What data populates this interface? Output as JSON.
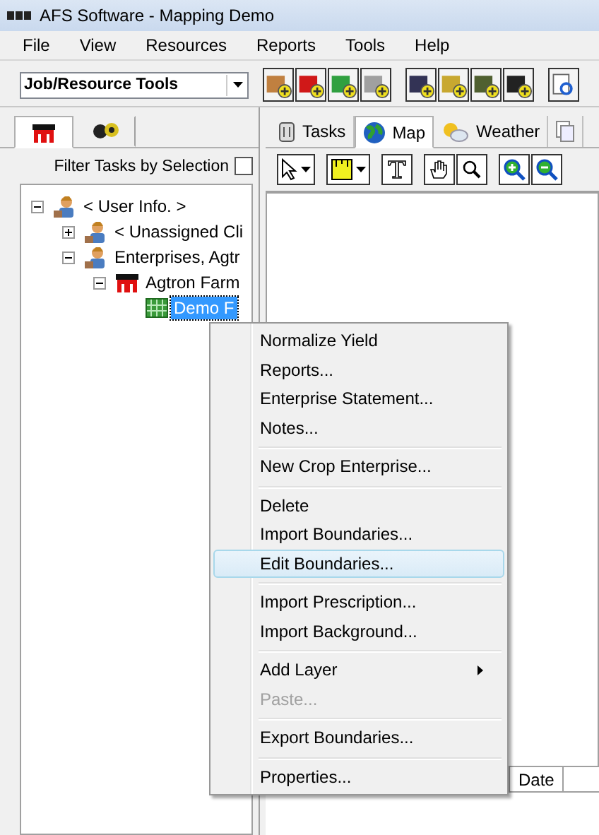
{
  "window": {
    "title": "AFS Software - Mapping Demo"
  },
  "menu_bar": [
    "File",
    "View",
    "Resources",
    "Reports",
    "Tools",
    "Help"
  ],
  "toolbar": {
    "dropdown": {
      "value": "Job/Resource Tools"
    }
  },
  "left_panel": {
    "tabs": [
      {
        "kind": "farm",
        "selected": true
      },
      {
        "kind": "resources",
        "selected": false
      }
    ],
    "filter": {
      "label": "Filter Tasks by Selection",
      "checked": false
    },
    "tree": [
      {
        "kind": "user",
        "label": "< User Info. >",
        "expanded": true,
        "selected": false,
        "children": [
          {
            "kind": "user",
            "label": "< Unassigned Cli",
            "expanded": false,
            "selected": false
          },
          {
            "kind": "user",
            "label": "Enterprises, Agtr",
            "expanded": true,
            "selected": false,
            "children": [
              {
                "kind": "farm",
                "label": "Agtron Farm",
                "expanded": true,
                "selected": false,
                "children": [
                  {
                    "kind": "field",
                    "label": "Demo F",
                    "selected": true
                  }
                ]
              }
            ]
          }
        ]
      }
    ]
  },
  "right_panel": {
    "tabs": [
      {
        "kind": "tasks",
        "label": "Tasks",
        "selected": false
      },
      {
        "kind": "map",
        "label": "Map",
        "selected": true
      },
      {
        "kind": "weather",
        "label": "Weather",
        "selected": false
      },
      {
        "kind": "report",
        "selected": false
      }
    ],
    "table": {
      "columns": [
        "",
        "Date"
      ]
    }
  },
  "context_menu": [
    {
      "kind": "item",
      "label": "Normalize Yield",
      "selected": false,
      "disabled": false,
      "submenu": false
    },
    {
      "kind": "item",
      "label": "Reports...",
      "selected": false,
      "disabled": false,
      "submenu": false
    },
    {
      "kind": "item",
      "label": "Enterprise Statement...",
      "selected": false,
      "disabled": false,
      "submenu": false
    },
    {
      "kind": "item",
      "label": "Notes...",
      "selected": false,
      "disabled": false,
      "submenu": false
    },
    {
      "kind": "separator"
    },
    {
      "kind": "item",
      "label": "New Crop Enterprise...",
      "selected": false,
      "disabled": false,
      "submenu": false
    },
    {
      "kind": "separator"
    },
    {
      "kind": "item",
      "label": "Delete",
      "selected": false,
      "disabled": false,
      "submenu": false
    },
    {
      "kind": "item",
      "label": "Import Boundaries...",
      "selected": false,
      "disabled": false,
      "submenu": false
    },
    {
      "kind": "item",
      "label": "Edit Boundaries...",
      "selected": true,
      "disabled": false,
      "submenu": false
    },
    {
      "kind": "separator"
    },
    {
      "kind": "item",
      "label": "Import Prescription...",
      "selected": false,
      "disabled": false,
      "submenu": false
    },
    {
      "kind": "item",
      "label": "Import Background...",
      "selected": false,
      "disabled": false,
      "submenu": false
    },
    {
      "kind": "separator"
    },
    {
      "kind": "item",
      "label": "Add Layer",
      "selected": false,
      "disabled": false,
      "submenu": true
    },
    {
      "kind": "item",
      "label": "Paste...",
      "selected": false,
      "disabled": true,
      "submenu": false
    },
    {
      "kind": "separator"
    },
    {
      "kind": "item",
      "label": "Export Boundaries...",
      "selected": false,
      "disabled": false,
      "submenu": false
    },
    {
      "kind": "separator"
    },
    {
      "kind": "item",
      "label": "Properties...",
      "selected": false,
      "disabled": false,
      "submenu": false
    }
  ]
}
